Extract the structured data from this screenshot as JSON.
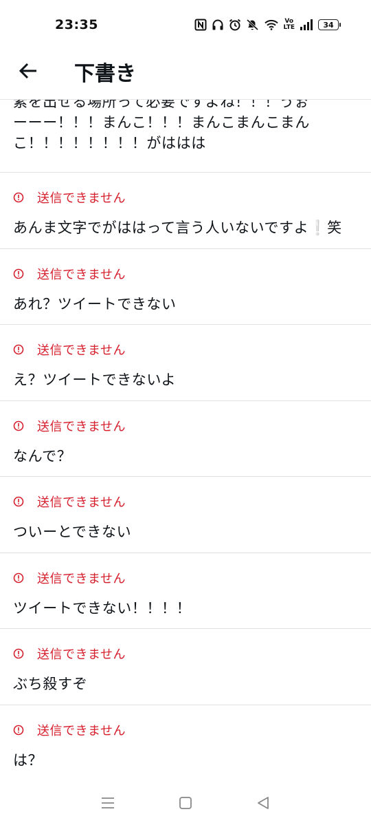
{
  "status_bar": {
    "time": "23:35",
    "volte_top": "Vo",
    "volte_bottom": "LTE",
    "battery": "34",
    "icons": [
      "nfc-icon",
      "headphones-icon",
      "alarm-icon",
      "mute-icon",
      "wifi-icon",
      "volte-icon",
      "signal-icon",
      "battery-icon"
    ]
  },
  "header": {
    "back_icon": "arrow-left-icon",
    "title": "下書き"
  },
  "first_draft": {
    "lines": [
      "素を出せる場所って必要ですよね！！！うぉ",
      "ーーー！！！まんこ！！！まんこまんこまん",
      "こ！！！！！！！！がははは"
    ]
  },
  "drafts": [
    {
      "error": "送信できません",
      "text": "あんま文字でがははって言う人いないですよ❕笑"
    },
    {
      "error": "送信できません",
      "text": "あれ？ツイートできない"
    },
    {
      "error": "送信できません",
      "text": "え？ツイートできないよ"
    },
    {
      "error": "送信できません",
      "text": "なんで？"
    },
    {
      "error": "送信できません",
      "text": "ついーとできない"
    },
    {
      "error": "送信できません",
      "text": "ツイートできない！！！！"
    },
    {
      "error": "送信できません",
      "text": "ぶち殺すぞ"
    },
    {
      "error": "送信できません",
      "text": "は？"
    }
  ],
  "colors": {
    "error": "#d6202e",
    "text": "#0f1419",
    "divider": "#e1e1e1"
  },
  "nav_bar": {
    "icons": [
      "menu-icon",
      "home-square-icon",
      "back-triangle-icon"
    ]
  }
}
